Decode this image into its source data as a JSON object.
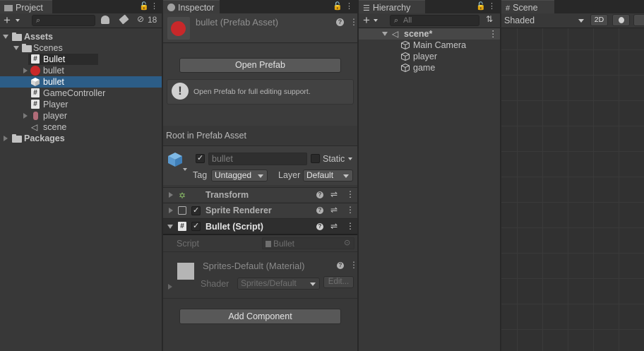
{
  "project": {
    "tab_label": "Project",
    "hidden_count": "18",
    "search_placeholder": "",
    "tree": {
      "assets": "Assets",
      "scenes": "Scenes",
      "items": [
        "Bullet",
        "bullet",
        "bullet",
        "GameController",
        "Player",
        "player",
        "scene"
      ],
      "packages": "Packages"
    }
  },
  "inspector": {
    "tab_label": "Inspector",
    "asset_title": "bullet (Prefab Asset)",
    "open_prefab_label": "Open Prefab",
    "info_text": "Open Prefab for full editing support.",
    "root_label": "Root in Prefab Asset",
    "object_name": "bullet",
    "static_label": "Static",
    "tag_label": "Tag",
    "tag_value": "Untagged",
    "layer_label": "Layer",
    "layer_value": "Default",
    "components": {
      "transform": "Transform",
      "sprite_renderer": "Sprite Renderer",
      "bullet_script": "Bullet (Script)"
    },
    "script_field_label": "Script",
    "script_field_value": "Bullet",
    "material_name": "Sprites-Default (Material)",
    "shader_label": "Shader",
    "shader_value": "Sprites/Default",
    "edit_label": "Edit...",
    "add_component_label": "Add Component"
  },
  "hierarchy": {
    "tab_label": "Hierarchy",
    "search_placeholder": "All",
    "scene_name": "scene*",
    "objects": [
      "Main Camera",
      "player",
      "game"
    ]
  },
  "scene": {
    "tab_label": "Scene",
    "shading_mode": "Shaded",
    "mode_2d": "2D"
  },
  "colors": {
    "selection": "#2c5d87",
    "panel_bg": "#383838",
    "prefab_red": "#c8282a"
  }
}
